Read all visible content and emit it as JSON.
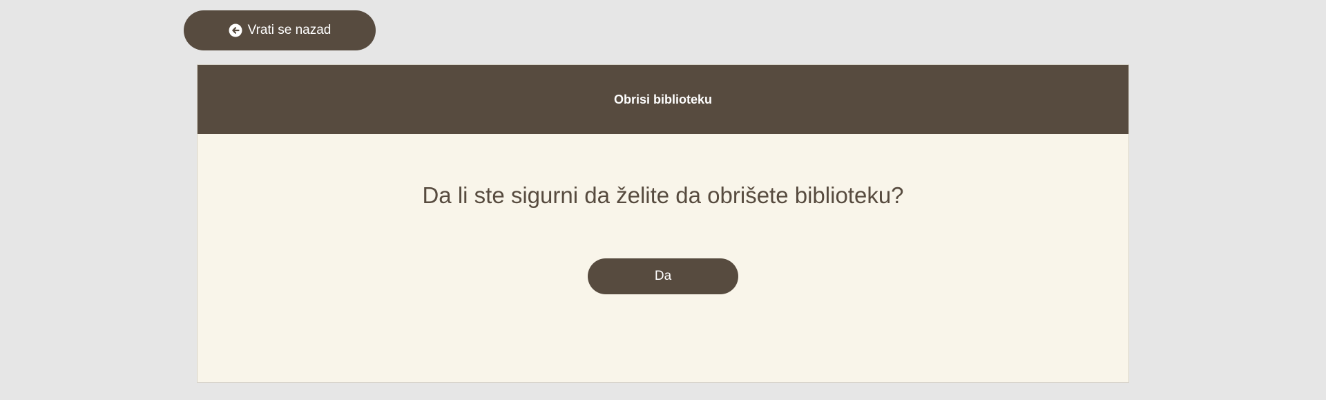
{
  "back_button": {
    "label": "Vrati se nazad",
    "icon": "arrow-circle-left-icon"
  },
  "card": {
    "title": "Obrisi biblioteku",
    "question": "Da li ste sigurni da želite da obrišete biblioteku?",
    "confirm_label": "Da"
  },
  "colors": {
    "background": "#e6e6e6",
    "primary": "#574b3f",
    "card_background": "#f9f5ea",
    "text_on_primary": "#ffffff"
  }
}
